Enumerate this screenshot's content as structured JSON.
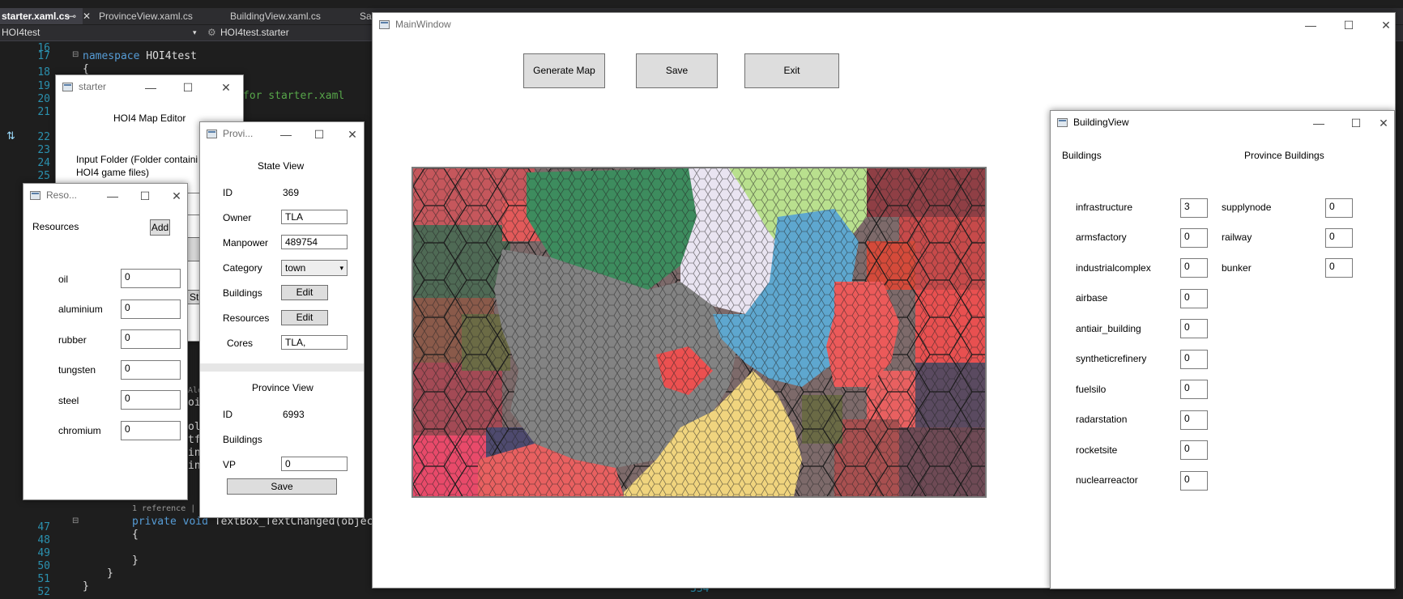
{
  "ide": {
    "tabs": [
      "starter.xaml.cs",
      "ProvinceView.xaml.cs",
      "BuildingView.xaml.cs",
      "Sa"
    ],
    "pin_glyph": "⊸",
    "close_glyph": "✕",
    "nav_project": "HOI4test",
    "nav_class": "HOI4test.starter",
    "line_numbers": [
      "16",
      "17",
      "18",
      "19",
      "20",
      "21",
      "22",
      "23",
      "24",
      "25",
      "",
      "",
      "",
      "",
      "",
      "",
      "",
      "",
      "",
      "",
      "",
      "",
      "",
      "",
      "",
      "",
      "",
      "",
      "",
      "",
      "",
      "47",
      "48",
      "49",
      "50",
      "51",
      "52"
    ],
    "code": {
      "ns_keyword": "namespace",
      "ns_name": " HOI4test",
      "brace_open": "{",
      "comment_frag": "for starter.xaml",
      "private_line_kw": "private void",
      "private_line_rest": " TextBox_TextChanged(object",
      "ref_hint": "1 reference | Alex",
      "inner_open": "{",
      "inner_close": "}",
      "close1": "}",
      "close2": "}",
      "frag_bunch": [
        "ol",
        "tf",
        "in",
        "in"
      ],
      "frag_xa": [
        "Alex",
        "oi"
      ],
      "bottom_num": "334"
    }
  },
  "starter": {
    "title": "starter",
    "heading": "HOI4 Map Editor",
    "input_label_line1": "Input Folder (Folder containi",
    "input_label_line2": "HOI4 game files)",
    "st_frag": "St"
  },
  "resources": {
    "title": "Reso...",
    "header": "Resources",
    "add_label": "Add",
    "items": [
      {
        "name": "oil",
        "value": "0"
      },
      {
        "name": "aluminium",
        "value": "0"
      },
      {
        "name": "rubber",
        "value": "0"
      },
      {
        "name": "tungsten",
        "value": "0"
      },
      {
        "name": "steel",
        "value": "0"
      },
      {
        "name": "chromium",
        "value": "0"
      }
    ]
  },
  "province": {
    "title": "Provi...",
    "state_header": "State View",
    "id_label": "ID",
    "id_value": "369",
    "owner_label": "Owner",
    "owner_value": "TLA",
    "manpower_label": "Manpower",
    "manpower_value": "489754",
    "category_label": "Category",
    "category_value": "town",
    "buildings_label": "Buildings",
    "buildings_edit": "Edit",
    "resources_label": "Resources",
    "resources_edit": "Edit",
    "cores_label": "Cores",
    "cores_value": "TLA,",
    "prov_header": "Province View",
    "prov_id_label": "ID",
    "prov_id_value": "6993",
    "prov_buildings_label": "Buildings",
    "vp_label": "VP",
    "vp_value": "0",
    "save_label": "Save"
  },
  "main": {
    "title": "MainWindow",
    "generate_label": "Generate Map",
    "save_label": "Save",
    "exit_label": "Exit"
  },
  "building": {
    "title": "BuildingView",
    "left_header": "Buildings",
    "right_header": "Province Buildings",
    "items": [
      {
        "name": "infrastructure",
        "value": "3"
      },
      {
        "name": "armsfactory",
        "value": "0"
      },
      {
        "name": "industrialcomplex",
        "value": "0"
      },
      {
        "name": "airbase",
        "value": "0"
      },
      {
        "name": "antiair_building",
        "value": "0"
      },
      {
        "name": "syntheticrefinery",
        "value": "0"
      },
      {
        "name": "fuelsilo",
        "value": "0"
      },
      {
        "name": "radarstation",
        "value": "0"
      },
      {
        "name": "rocketsite",
        "value": "0"
      },
      {
        "name": "nuclearreactor",
        "value": "0"
      }
    ],
    "province_items": [
      {
        "name": "supplynode",
        "value": "0"
      },
      {
        "name": "railway",
        "value": "0"
      },
      {
        "name": "bunker",
        "value": "0"
      }
    ]
  },
  "colors": {
    "ide_bg": "#1e1e1e",
    "button_bg": "#dddddd",
    "map_green": "#3d8c5e",
    "map_gray": "#838383",
    "map_lavender": "#e9e4f1",
    "map_blue": "#5ea7cf",
    "map_red": "#ec5a5a",
    "map_yellow": "#f0d47e"
  },
  "icons": {
    "window": "window-icon",
    "minimize": "minimize-icon",
    "maximize": "maximize-icon",
    "close": "close-icon",
    "dropdown": "chevron-down-icon"
  }
}
